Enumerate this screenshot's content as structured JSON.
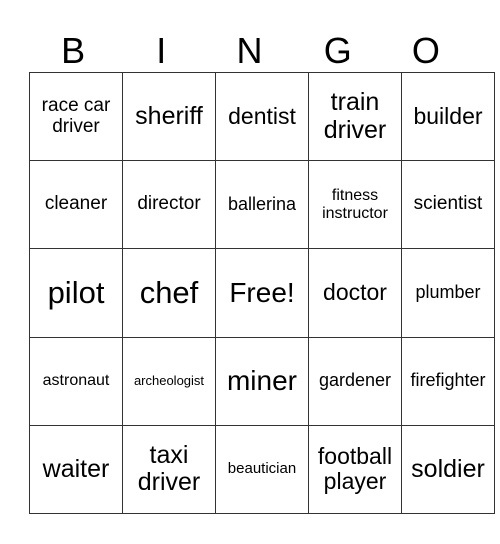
{
  "header": [
    "B",
    "I",
    "N",
    "G",
    "O"
  ],
  "grid": [
    [
      "race car driver",
      "sheriff",
      "dentist",
      "train driver",
      "builder"
    ],
    [
      "cleaner",
      "director",
      "ballerina",
      "fitness instructor",
      "scientist"
    ],
    [
      "pilot",
      "chef",
      "Free!",
      "doctor",
      "plumber"
    ],
    [
      "astronaut",
      "archeologist",
      "miner",
      "gardener",
      "firefighter"
    ],
    [
      "waiter",
      "taxi driver",
      "beautician",
      "football player",
      "soldier"
    ]
  ]
}
